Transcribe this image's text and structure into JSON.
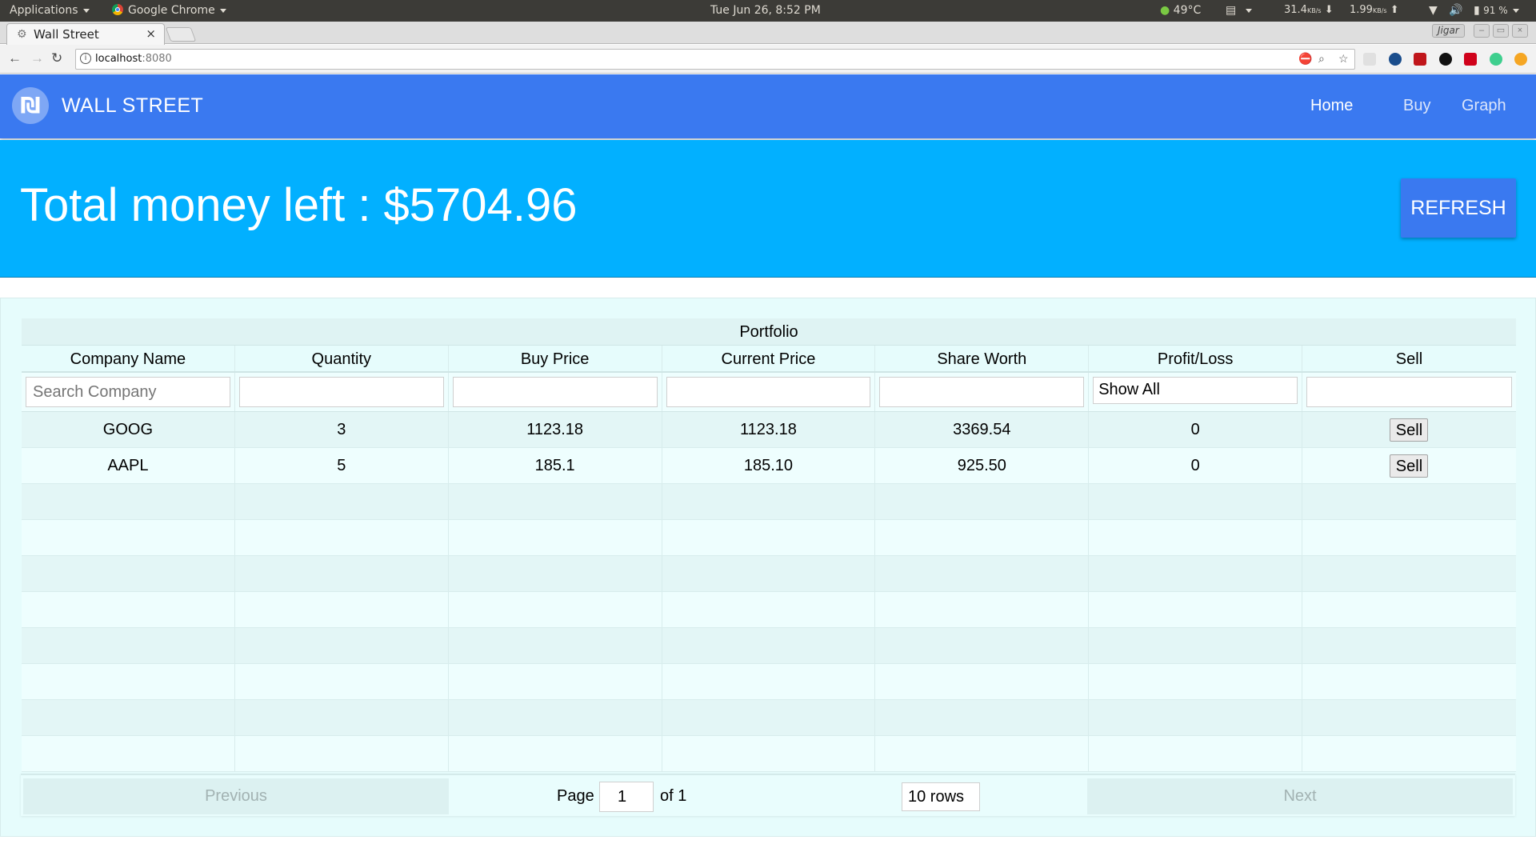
{
  "os_panel": {
    "applications": "Applications",
    "browser": "Google Chrome",
    "datetime": "Tue Jun 26,  8:52 PM",
    "temperature": "49°C",
    "net_down": "31.4",
    "net_down_unit": "KB/s",
    "net_up": "1.99",
    "net_up_unit": "KB/s",
    "battery": "91 %"
  },
  "browser": {
    "tab_title": "Wall Street",
    "user": "Jigar",
    "url_host": "localhost",
    "url_port": ":8080"
  },
  "nav": {
    "brand": "WALL STREET",
    "logo_glyph": "₪",
    "links": [
      "Home",
      "Buy",
      "Graph"
    ]
  },
  "banner": {
    "total_text": "Total money left : $5704.96",
    "refresh_label": "REFRESH"
  },
  "table": {
    "caption": "Portfolio",
    "columns": [
      "Company Name",
      "Quantity",
      "Buy Price",
      "Current Price",
      "Share Worth",
      "Profit/Loss",
      "Sell"
    ],
    "search_placeholder": "Search Company",
    "profit_filter": "Show All",
    "rows": [
      {
        "company": "GOOG",
        "quantity": "3",
        "buy_price": "1123.18",
        "current_price": "1123.18",
        "share_worth": "3369.54",
        "profit_loss": "0",
        "action": "Sell"
      },
      {
        "company": "AAPL",
        "quantity": "5",
        "buy_price": "185.1",
        "current_price": "185.10",
        "share_worth": "925.50",
        "profit_loss": "0",
        "action": "Sell"
      }
    ]
  },
  "pagination": {
    "previous": "Previous",
    "next": "Next",
    "page_label": "Page",
    "page_value": "1",
    "of_label": "of 1",
    "rows_label": "10 rows"
  }
}
